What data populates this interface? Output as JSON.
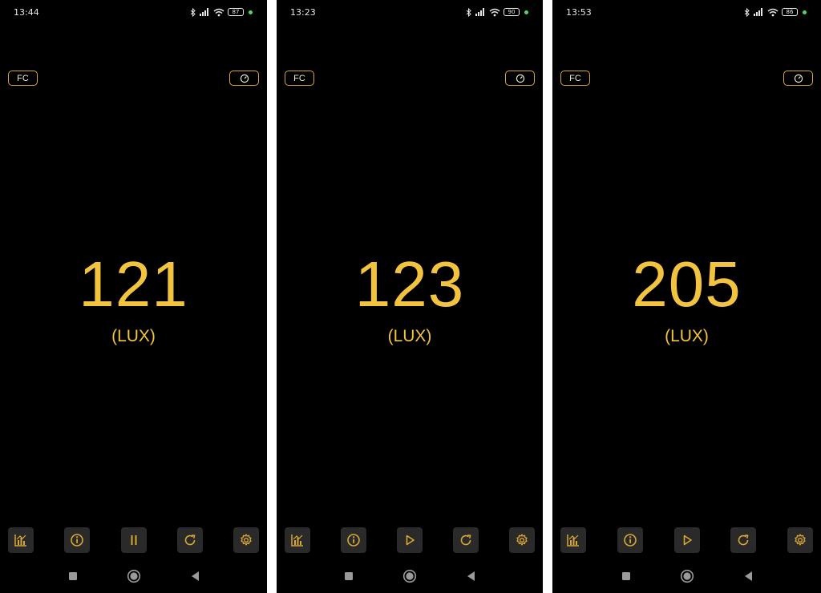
{
  "colors": {
    "background": "#000000",
    "accent": "#f1c33f",
    "button_border": "#d9a832",
    "toolbar_button": "#2a2a2a",
    "status_dot": "#4cd964"
  },
  "screens": [
    {
      "status": {
        "time": "13:44",
        "battery": "87"
      },
      "unit_button": "FC",
      "reading": "121",
      "unit": "(LUX)",
      "playback_icon": "pause-icon"
    },
    {
      "status": {
        "time": "13:23",
        "battery": "90"
      },
      "unit_button": "FC",
      "reading": "123",
      "unit": "(LUX)",
      "playback_icon": "play-icon"
    },
    {
      "status": {
        "time": "13:53",
        "battery": "86"
      },
      "unit_button": "FC",
      "reading": "205",
      "unit": "(LUX)",
      "playback_icon": "play-icon"
    }
  ],
  "toolbar_icons": [
    "chart-icon",
    "info-icon",
    "playback-icon",
    "refresh-icon",
    "settings-icon"
  ],
  "nav_icons": [
    "recents-square-icon",
    "home-circle-icon",
    "back-triangle-icon"
  ]
}
